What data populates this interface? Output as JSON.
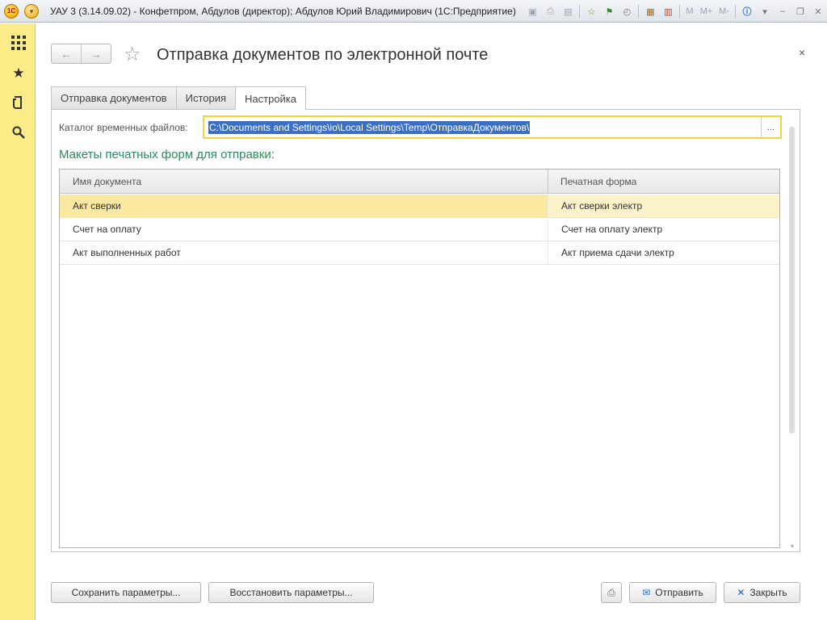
{
  "window": {
    "app_title": "УАУ 3 (3.14.09.02) - Конфетпром, Абдулов (директор); Абдулов Юрий Владимирович  (1С:Предприятие)",
    "logo_text": "1С",
    "toolbar": {
      "m_label": "M",
      "m_plus_label": "M+",
      "m_minus_label": "M-"
    }
  },
  "sidebar": {
    "items": [
      {
        "icon": "apps-grid-icon"
      },
      {
        "icon": "favorites-star-icon"
      },
      {
        "icon": "history-icon"
      },
      {
        "icon": "search-icon"
      }
    ]
  },
  "header": {
    "title": "Отправка документов по электронной почте",
    "close": "×"
  },
  "tabs": [
    {
      "label": "Отправка документов",
      "active": false
    },
    {
      "label": "История",
      "active": false
    },
    {
      "label": "Настройка",
      "active": true
    }
  ],
  "settings": {
    "catalog_label": "Каталог временных файлов:",
    "catalog_value": "C:\\Documents and Settings\\io\\Local Settings\\Temp\\ОтправкаДокументов\\",
    "catalog_button": "...",
    "section_title": "Макеты печатных форм для отправки:",
    "grid": {
      "columns": [
        "Имя документа",
        "Печатная форма"
      ],
      "rows": [
        {
          "doc": "Акт сверки",
          "form": "Акт сверки электр",
          "selected": true
        },
        {
          "doc": "Счет на оплату",
          "form": "Счет на оплату электр",
          "selected": false
        },
        {
          "doc": "Акт выполненных работ",
          "form": "Акт приема сдачи электр",
          "selected": false
        }
      ]
    }
  },
  "footer": {
    "save_params": "Сохранить параметры...",
    "restore_params": "Восстановить параметры...",
    "send": "Отправить",
    "close": "Закрыть"
  },
  "colors": {
    "sidebar_bg": "#fbec88",
    "selection": "#fbe9a1",
    "section_title": "#2b8a5a",
    "input_focus": "#f5d340",
    "text_highlight": "#3b6fc4"
  }
}
